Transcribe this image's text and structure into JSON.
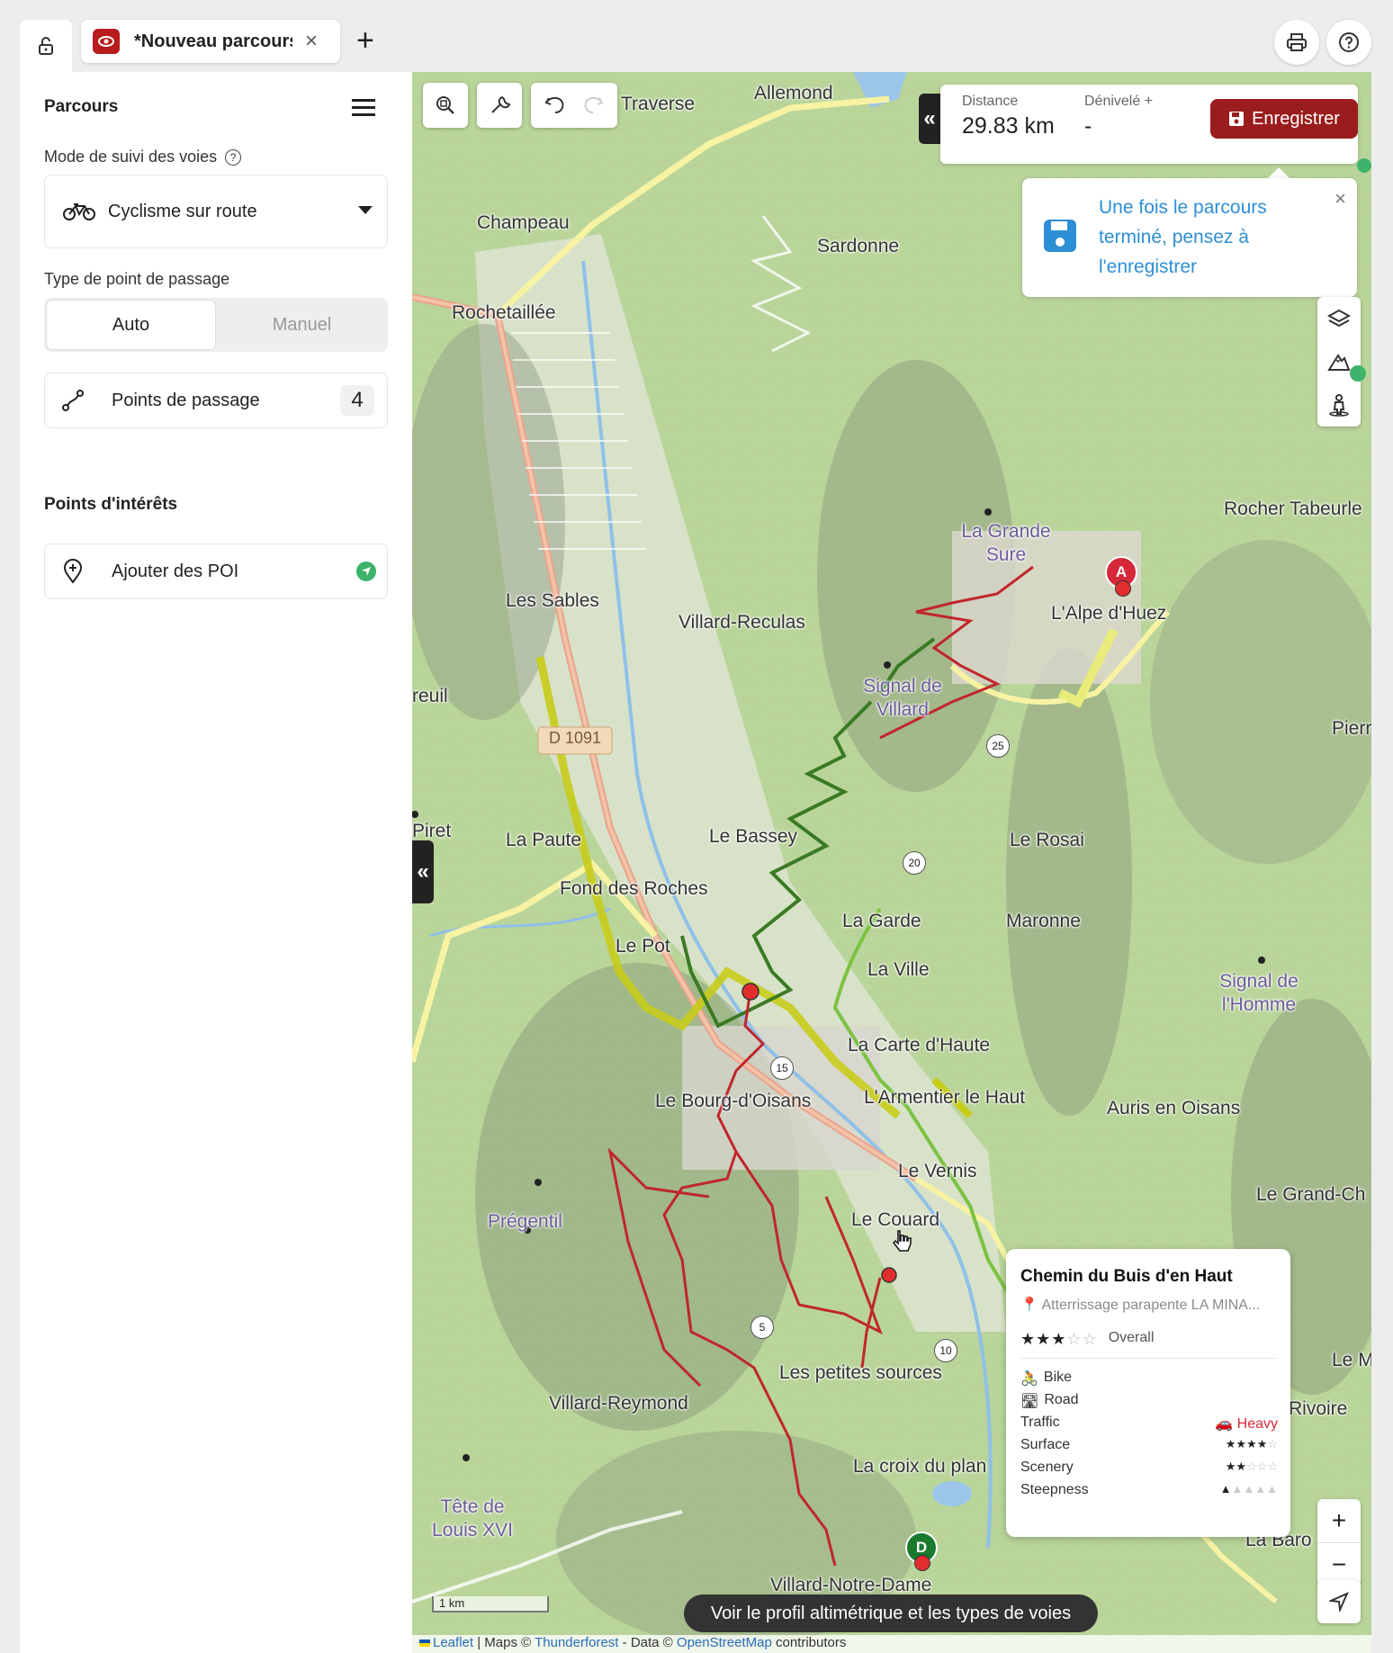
{
  "tabs": {
    "doc_title": "*Nouveau parcours",
    "close_label": "×",
    "add_label": "+"
  },
  "sidebar": {
    "title": "Parcours",
    "mode_label": "Mode de suivi des voies",
    "mode_value": "Cyclisme sur route",
    "waypoint_type_label": "Type de point de passage",
    "waypoint_auto": "Auto",
    "waypoint_manual": "Manuel",
    "waypoints_label": "Points de passage",
    "waypoints_count": "4",
    "poi_title": "Points d'intérêts",
    "poi_add": "Ajouter des POI"
  },
  "stats": {
    "distance_label": "Distance",
    "distance_value": "29.83 km",
    "elevation_label": "Dénivelé +",
    "elevation_value": "-",
    "save_label": "Enregistrer"
  },
  "tip": {
    "text": "Une fois le parcours terminé, pensez à l'enregistrer",
    "close": "×"
  },
  "places": {
    "traverse": "Traverse",
    "allemond": "Allemond",
    "champeau": "Champeau",
    "sardonne": "Sardonne",
    "rochetaillee": "Rochetaillée",
    "rocher": "Rocher Tabeurle",
    "grande_sure": "La Grande Sure",
    "alpe": "L'Alpe d'Huez",
    "sables": "Les Sables",
    "villard_reculas": "Villard-Reculas",
    "signal_villard": "Signal de Villard",
    "reuil": "reuil",
    "road_ref": "D 1091",
    "pier": "Pierr",
    "piret": "Piret",
    "paute": "La Paute",
    "bassey": "Le Bassey",
    "rosai": "Le Rosai",
    "fond_roches": "Fond des Roches",
    "garde": "La Garde",
    "maronne": "Maronne",
    "le_pot": "Le Pot",
    "la_ville": "La Ville",
    "signal_homme": "Signal de l'Homme",
    "carte_haute": "La Carte d'Haute",
    "bourg": "Le Bourg-d'Oisans",
    "armentier": "L'Armentier le Haut",
    "auris": "Auris en Oisans",
    "vernis": "Le Vernis",
    "grand_ch": "Le Grand-Ch",
    "pregentil": "Prégentil",
    "couard": "Le Couard",
    "le_m": "Le M",
    "rivoire": "Rivoire",
    "petites_sources": "Les petites sources",
    "villard_reymond": "Villard-Reymond",
    "croix_plan": "La croix du plan",
    "tete_louis": "Tête de Louis XVI",
    "la_baro": "La Baro",
    "villard_nd": "Villard-Notre-Dame"
  },
  "km_markers": [
    "25",
    "20",
    "15",
    "10",
    "5"
  ],
  "markers": {
    "start": "A",
    "end": "D"
  },
  "popup": {
    "title": "Chemin du Buis d'en Haut",
    "subtitle": "Atterrissage parapente LA MINA...",
    "overall_label": "Overall",
    "overall_rating": 3,
    "bike": "Bike",
    "road": "Road",
    "traffic_label": "Traffic",
    "traffic_value": "Heavy",
    "surface_label": "Surface",
    "surface_rating": 4,
    "scenery_label": "Scenery",
    "scenery_rating": 2,
    "steepness_label": "Steepness",
    "steepness_rating": 1
  },
  "map_bottom": {
    "profile_button": "Voir le profil altimétrique et les types de voies",
    "scale": "1 km",
    "attribution_leaflet": "Leaflet",
    "attribution_maps": "| Maps ©",
    "attribution_tf": "Thunderforest",
    "attribution_data": "- Data ©",
    "attribution_osm": "OpenStreetMap",
    "attribution_contrib": "contributors"
  },
  "colors": {
    "brand_red": "#b91c1c",
    "save_red": "#9b1c1c",
    "tip_blue": "#2d8fd5",
    "route_red": "#c0262b",
    "route_green": "#7cc242",
    "highlight_yellow": "#c8cc1a"
  }
}
